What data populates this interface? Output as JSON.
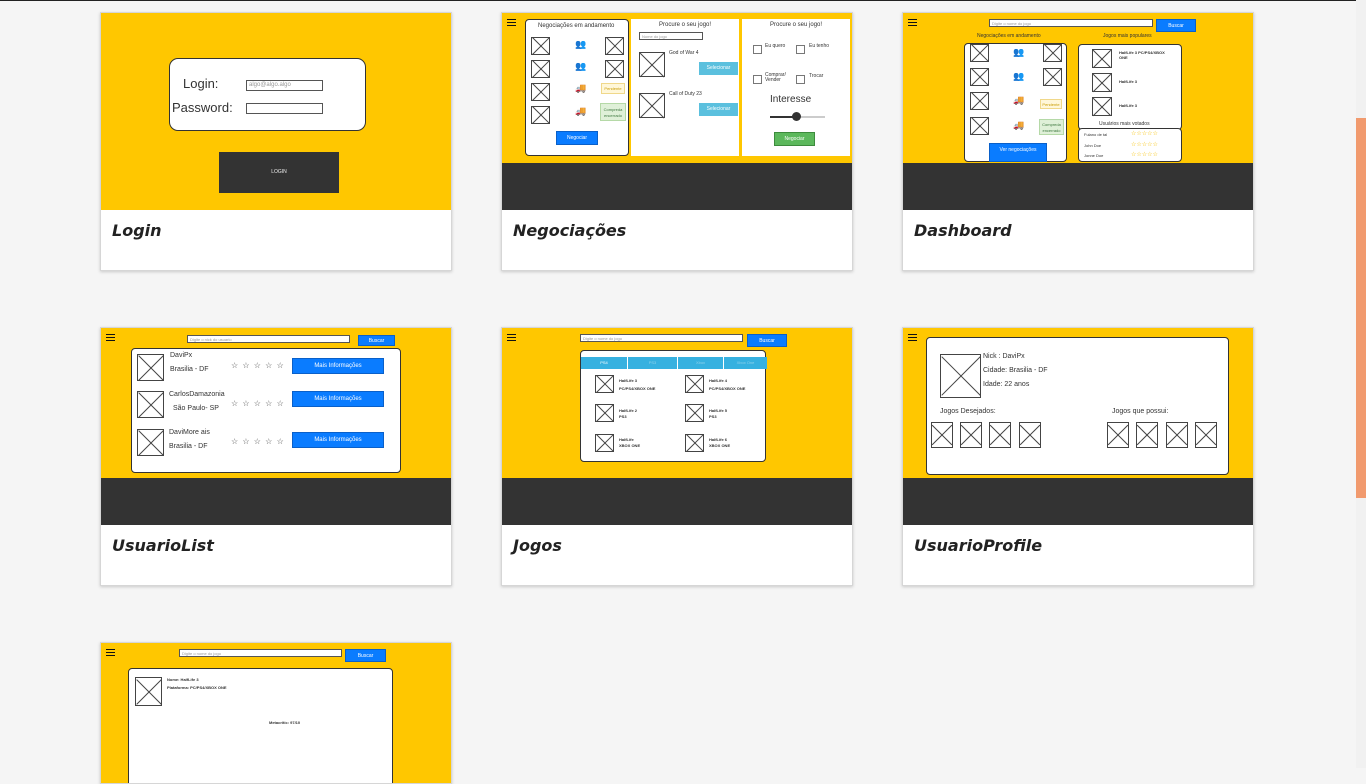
{
  "cards": [
    {
      "title": "Login"
    },
    {
      "title": "Negociações"
    },
    {
      "title": "Dashboard"
    },
    {
      "title": "UsuarioList"
    },
    {
      "title": "Jogos"
    },
    {
      "title": "UsuarioProfile"
    }
  ],
  "login": {
    "login_label": "Login:",
    "password_label": "Password:",
    "login_placeholder": "algo@algo.algo",
    "button": "LOGIN"
  },
  "negociacoes": {
    "panel1_title": "Negociações em andamento",
    "status_pending": "Pendente",
    "status_done": "Compreda encerrado",
    "negociar_btn": "Negociar",
    "panel2_title": "Procure o seu jogo!",
    "search_placeholder": "Nome do jogo",
    "games": [
      "God of War 4",
      "Call of Duty 23"
    ],
    "select_btn": "Selecionar",
    "panel3_title": "Procure o seu jogo!",
    "opt_quero": "Eu quero",
    "opt_tenho": "Eu tenho",
    "opt_comprar": "Comprar/ Vender",
    "opt_trocar": "Trocar",
    "interesse": "Interesse",
    "interesse_level": 0.5,
    "negociar_btn2": "Negociar"
  },
  "dashboard": {
    "search_placeholder": "Digite o nome do jogo",
    "buscar": "Buscar",
    "neg_title": "Negociações em andamento",
    "status_pending": "Pendente",
    "status_done": "Compreda encerrado",
    "ver_btn": "Ver negociações",
    "pop_title": "Jogos mais populares",
    "pop_games": [
      "HalfLife 3 PC/PS4/XBOX ONE",
      "HalfLife 3",
      "HalfLife 3"
    ],
    "users_title": "Usuários mais votados",
    "users": [
      "Fulano de tal",
      "John Doe",
      "Jonne Doe"
    ],
    "star_icons": "☆☆☆☆☆"
  },
  "usuariolist": {
    "search_placeholder": "Digite o nick do usuario",
    "buscar": "Buscar",
    "users": [
      {
        "nick": "DaviPx",
        "city": "Brasilia - DF"
      },
      {
        "nick": "CarlosDamazonia",
        "city": "São Paulo- SP"
      },
      {
        "nick": "DaviMore ais",
        "city": "Brasilia - DF"
      }
    ],
    "rating": "☆ ☆ ☆ ☆ ☆",
    "more_btn": "Mais Informações"
  },
  "jogos": {
    "search_placeholder": "Digite o nome do jogo",
    "buscar": "Buscar",
    "tabs": [
      "PS4",
      "PS3",
      "Xbox",
      "Xbox One"
    ],
    "games": [
      {
        "name": "HalfLife 3",
        "platform": "PC/PS4/XBOX ONE"
      },
      {
        "name": "HalfLife 4",
        "platform": "PC/PS4/XBOX ONE"
      },
      {
        "name": "HalfLife 2",
        "platform": "PS3"
      },
      {
        "name": "HalfLife 5",
        "platform": "PS3"
      },
      {
        "name": "HalfLife",
        "platform": "XBOX ONE"
      },
      {
        "name": "HalfLife 6",
        "platform": "XBOX ONE"
      }
    ]
  },
  "profile": {
    "nick": "Nick : DaviPx",
    "city": "Cidade: Brasilia - DF",
    "age": "Idade: 22 anos",
    "desired": "Jogos Desejados:",
    "owned": "Jogos que possui:"
  },
  "detail": {
    "search_placeholder": "Digite o nome do jogo",
    "buscar": "Buscar",
    "name": "Nome: HalfLife 3",
    "platform": "Plataforma: PC/PS4/XBOX ONE",
    "metacritic": "Metacritic: 97/10"
  }
}
